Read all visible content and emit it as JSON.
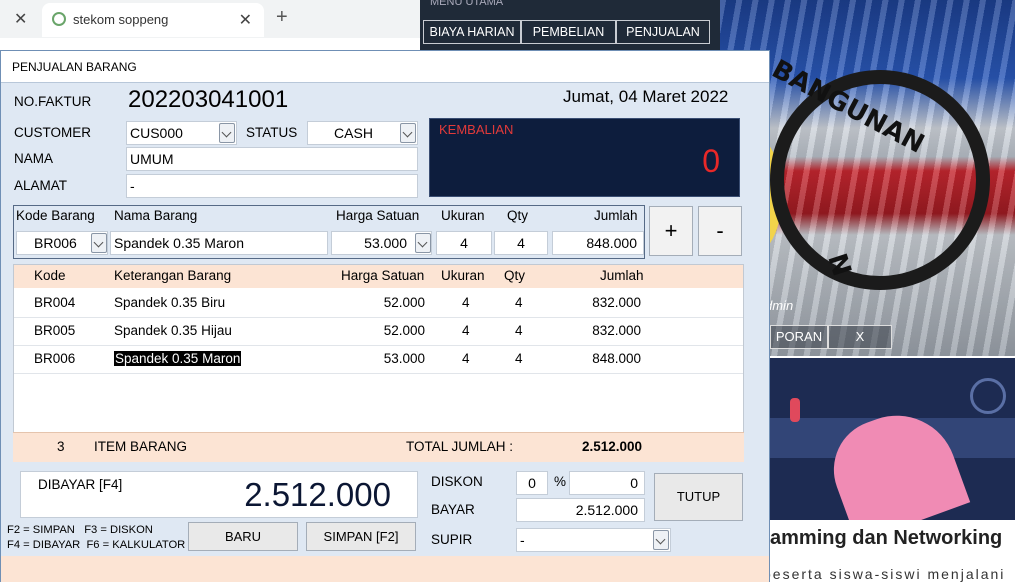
{
  "browser": {
    "tab_title": "stekom soppeng",
    "close": "✕",
    "new_tab": "+"
  },
  "background_app": {
    "menu_title": "MENU UTAMA",
    "menu_buttons": [
      "BIAYA HARIAN",
      "PEMBELIAN",
      "PENJUALAN"
    ],
    "banner_word": "BANGUNAN",
    "banner_letter": "N",
    "admin_text": "dmin",
    "bottom_buttons": [
      "PORAN",
      "X"
    ],
    "article_heading": "amming dan Networking",
    "article_text": "peserta siswa-siswi menjalani"
  },
  "window": {
    "title": "PENJUALAN BARANG",
    "no_faktur_label": "NO.FAKTUR",
    "no_faktur": "202203041001",
    "date": "Jumat, 04 Maret 2022",
    "customer_label": "CUSTOMER",
    "customer": "CUS000",
    "status_label": "STATUS",
    "status": "CASH",
    "nama_label": "NAMA",
    "nama": "UMUM",
    "alamat_label": "ALAMAT",
    "alamat": "-",
    "kembalian_label": "KEMBALIAN",
    "kembalian": "0"
  },
  "entry": {
    "headers": {
      "kode": "Kode Barang",
      "nama": "Nama Barang",
      "harga": "Harga Satuan",
      "ukuran": "Ukuran",
      "qty": "Qty",
      "jumlah": "Jumlah"
    },
    "kode": "BR006",
    "nama": "Spandek 0.35 Maron",
    "harga": "53.000",
    "ukuran": "4",
    "qty": "4",
    "jumlah": "848.000",
    "plus": "+",
    "minus": "-"
  },
  "grid": {
    "headers": {
      "kode": "Kode",
      "keterangan": "Keterangan Barang",
      "harga": "Harga Satuan",
      "ukuran": "Ukuran",
      "qty": "Qty",
      "jumlah": "Jumlah"
    },
    "rows": [
      {
        "kode": "BR004",
        "keterangan": "Spandek 0.35 Biru",
        "harga": "52.000",
        "ukuran": "4",
        "qty": "4",
        "jumlah": "832.000"
      },
      {
        "kode": "BR005",
        "keterangan": "Spandek 0.35 Hijau",
        "harga": "52.000",
        "ukuran": "4",
        "qty": "4",
        "jumlah": "832.000"
      },
      {
        "kode": "BR006",
        "keterangan": "Spandek 0.35 Maron",
        "harga": "53.000",
        "ukuran": "4",
        "qty": "4",
        "jumlah": "848.000"
      }
    ]
  },
  "summary": {
    "count": "3",
    "item_label": "ITEM BARANG",
    "total_label": "TOTAL JUMLAH :",
    "total": "2.512.000"
  },
  "payment": {
    "dibayar_label": "DIBAYAR [F4]",
    "dibayar": "2.512.000",
    "diskon_label": "DISKON",
    "diskon_pct": "0",
    "pct_sign": "%",
    "diskon_val": "0",
    "bayar_label": "BAYAR",
    "bayar": "2.512.000",
    "supir_label": "SUPIR",
    "supir": "-",
    "hotkeys": "F2 = SIMPAN   F3 = DISKON\nF4 = DIBAYAR  F6 = KALKULATOR",
    "baru": "BARU",
    "simpan": "SIMPAN [F2]",
    "tutup": "TUTUP"
  }
}
